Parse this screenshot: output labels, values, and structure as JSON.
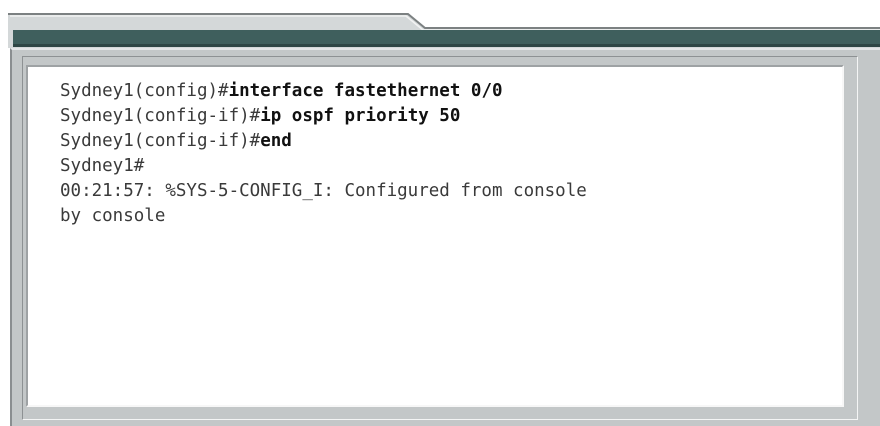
{
  "console": {
    "lines": [
      {
        "prompt": "Sydney1(config)#",
        "command": "interface fastethernet 0/0"
      },
      {
        "prompt": "Sydney1(config-if)#",
        "command": "ip ospf priority 50"
      },
      {
        "prompt": "Sydney1(config-if)#",
        "command": "end"
      },
      {
        "prompt": "Sydney1#",
        "command": ""
      },
      {
        "prompt": "00:21:57: %SYS-5-CONFIG_I: Configured from console",
        "command": ""
      },
      {
        "prompt": "by console",
        "command": ""
      }
    ]
  },
  "colors": {
    "header_bar": "#3f5f5d",
    "frame_gray": "#c3c7c8",
    "console_bg": "#ffffff"
  }
}
